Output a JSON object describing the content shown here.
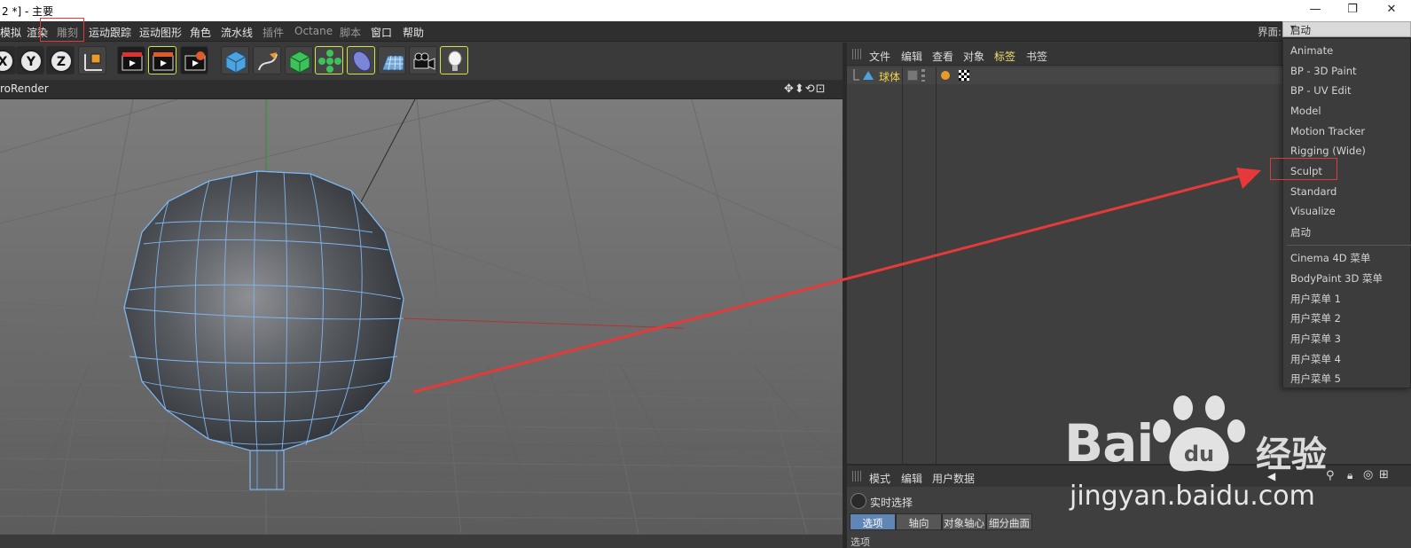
{
  "window": {
    "title": "2 *] - 主要",
    "buttons": {
      "minimize": "—",
      "restore": "❐",
      "close": "✕"
    }
  },
  "menubar": {
    "items": [
      "模拟",
      "渲染",
      "雕刻",
      "运动跟踪",
      "运动图形",
      "角色",
      "流水线",
      "插件",
      "Octane",
      "脚本",
      "窗口",
      "帮助"
    ],
    "layout_label": "界面:",
    "layout_value": "启动"
  },
  "toolbar": {
    "icons": [
      "x-axis-icon",
      "y-axis-icon",
      "z-axis-icon",
      "world-coordinate-icon",
      "render-view-icon",
      "render-picture-viewer-icon",
      "render-settings-icon",
      "cube-icon",
      "pen-spline-icon",
      "subdivision-surface-icon",
      "array-icon",
      "deformer-icon",
      "floor-icon",
      "camera-icon",
      "light-icon"
    ]
  },
  "viewport": {
    "name": "roRender",
    "nav_icons": "✥⬍⟲⊡"
  },
  "object_manager": {
    "menu": [
      "文件",
      "编辑",
      "查看",
      "对象",
      "标签",
      "书签"
    ],
    "active_menu": "标签",
    "objects": [
      {
        "name": "球体"
      }
    ]
  },
  "attribute_manager": {
    "menu": [
      "模式",
      "编辑",
      "用户数据"
    ],
    "tool_name": "实时选择",
    "tabs": [
      "选项",
      "轴向",
      "对象轴心",
      "细分曲面"
    ],
    "active_tab": "选项",
    "bottom_text": "选项"
  },
  "layout_dropdown": {
    "group1": [
      "Animate",
      "BP - 3D Paint",
      "BP - UV Edit",
      "Model",
      "Motion Tracker",
      "Rigging (Wide)",
      "Sculpt",
      "Standard",
      "Visualize",
      "启动"
    ],
    "group2": [
      "Cinema 4D 菜单",
      "BodyPaint 3D 菜单",
      "用户菜单 1",
      "用户菜单 2",
      "用户菜单 3",
      "用户菜单 4",
      "用户菜单 5"
    ],
    "highlighted": "Sculpt"
  },
  "watermark": {
    "brand": "Bai",
    "brand_cn": "经验",
    "url": "jingyan.baidu.com"
  },
  "colors": {
    "accent_yellow": "#d7e14a",
    "annotation_red": "#e03b3b",
    "active_tab_blue": "#5f86b5",
    "mesh_wire": "#7fb6ee"
  }
}
